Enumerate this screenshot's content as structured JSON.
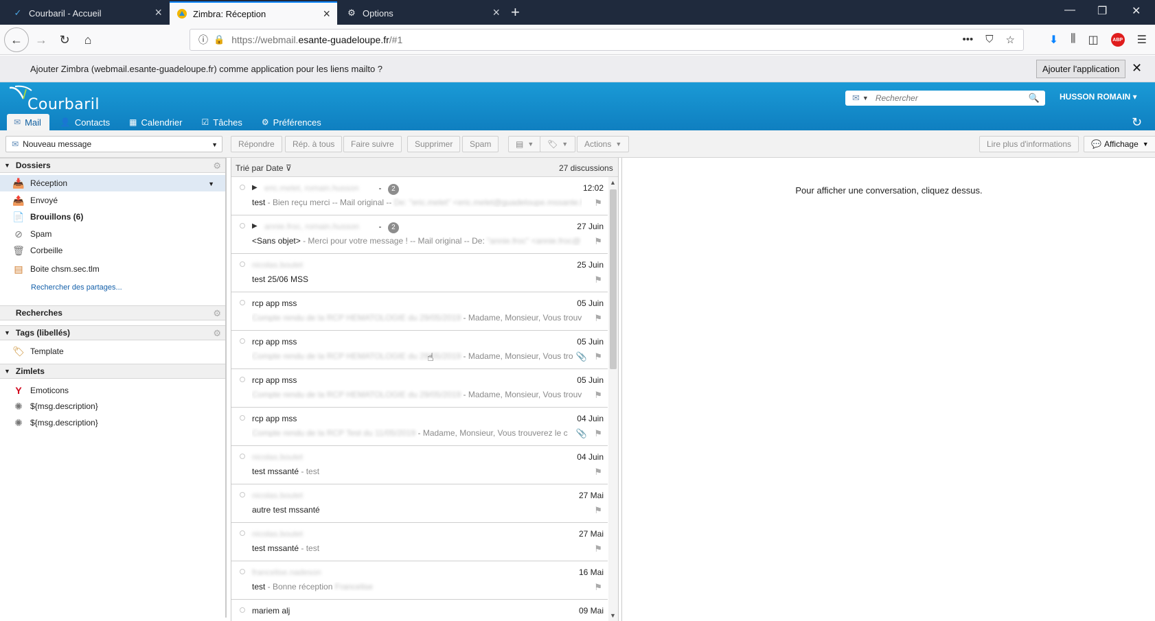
{
  "browser": {
    "tabs": [
      {
        "label": "Courbaril - Accueil",
        "icon": "courbaril-icon"
      },
      {
        "label": "Zimbra: Réception",
        "icon": "zimbra-icon"
      },
      {
        "label": "Options",
        "icon": "gear-icon"
      }
    ],
    "url": {
      "prefix": "https://webmail.",
      "domain": "esante-guadeloupe.fr",
      "suffix": "/#1"
    }
  },
  "notification": {
    "text": "Ajouter Zimbra (webmail.esante-guadeloupe.fr) comme application pour les liens mailto ?",
    "button_label": "Ajouter l'application"
  },
  "app": {
    "logo_text": "Courbaril",
    "search_placeholder": "Rechercher",
    "user_name": "HUSSON ROMAIN",
    "tabs": [
      "Mail",
      "Contacts",
      "Calendrier",
      "Tâches",
      "Préférences"
    ]
  },
  "toolbar": {
    "new_message": "Nouveau message",
    "reply": "Répondre",
    "reply_all": "Rép. à tous",
    "forward": "Faire suivre",
    "delete": "Supprimer",
    "spam": "Spam",
    "actions": "Actions",
    "more_info": "Lire plus d'informations",
    "view": "Affichage"
  },
  "sidebar": {
    "folders_header": "Dossiers",
    "folders": [
      {
        "label": "Réception",
        "icon": "inbox-icon"
      },
      {
        "label": "Envoyé",
        "icon": "sent-icon"
      },
      {
        "label": "Brouillons (6)",
        "icon": "drafts-icon"
      },
      {
        "label": "Spam",
        "icon": "spam-icon"
      },
      {
        "label": "Corbeille",
        "icon": "trash-icon"
      },
      {
        "label": "Boite chsm.sec.tlm",
        "icon": "shared-mailbox-icon"
      }
    ],
    "find_shares": "Rechercher des partages...",
    "searches_header": "Recherches",
    "tags_header": "Tags (libellés)",
    "tags": [
      {
        "label": "Template",
        "icon": "tag-icon"
      }
    ],
    "zimlets_header": "Zimlets",
    "zimlets": [
      {
        "label": "Emoticons",
        "icon": "yahoo-icon"
      },
      {
        "label": "${msg.description}",
        "icon": "zimlet-icon"
      },
      {
        "label": "${msg.description}",
        "icon": "zimlet-icon"
      }
    ]
  },
  "list": {
    "sort_label": "Trié par Date",
    "count_label": "27 discussions",
    "messages": [
      {
        "from": "eric.melet, romain.husson",
        "count": "2",
        "date": "12:02",
        "subject": "test",
        "fragment": " - Bien reçu merci -- Mail original -- ",
        "blur_tail": "De: \"eric.melet\" <eric.melet@guadeloupe.mssante.fr>",
        "expand": true,
        "attach": false,
        "from_blur": true
      },
      {
        "from": "annie.froc, romain.husson",
        "count": "2",
        "date": "27 Juin",
        "subject": "<Sans objet>",
        "fragment": " - Merci pour votre message ! -- Mail original -- De: ",
        "blur_tail": "\"annie.froc\" <annie.froc@",
        "expand": true,
        "attach": false,
        "from_blur": true
      },
      {
        "from": "nicolas.boutet",
        "count": "",
        "date": "25 Juin",
        "subject": "test 25/06 MSS",
        "fragment": "",
        "blur_tail": "",
        "expand": false,
        "attach": false,
        "from_blur": true
      },
      {
        "from": "rcp app mss",
        "count": "",
        "date": "05 Juin",
        "subject": "",
        "fragment": " - Madame, Monsieur, Vous trouve",
        "blur_tail": "Compte rendu de la RCP HEMATOLOGIE du 29/05/2019",
        "blur_first": true,
        "expand": false,
        "attach": false,
        "from_blur": false
      },
      {
        "from": "rcp app mss",
        "count": "",
        "date": "05 Juin",
        "subject": "",
        "fragment": " - Madame, Monsieur, Vous tro",
        "blur_tail": "Compte rendu de la RCP HEMATOLOGIE du 29/05/2019",
        "blur_first": true,
        "expand": false,
        "attach": true,
        "from_blur": false
      },
      {
        "from": "rcp app mss",
        "count": "",
        "date": "05 Juin",
        "subject": "",
        "fragment": " - Madame, Monsieur, Vous trouve",
        "blur_tail": "Compte rendu de la RCP HEMATOLOGIE du 29/05/2019",
        "blur_first": true,
        "expand": false,
        "attach": false,
        "from_blur": false
      },
      {
        "from": "rcp app mss",
        "count": "",
        "date": "04 Juin",
        "subject": "",
        "fragment": " - Madame, Monsieur, Vous trouverez le c",
        "blur_tail": "Compte rendu de la RCP Test du 11/05/2019",
        "blur_first": true,
        "expand": false,
        "attach": true,
        "from_blur": false
      },
      {
        "from": "nicolas.boutet",
        "count": "",
        "date": "04 Juin",
        "subject": "test mssanté",
        "fragment": " - test",
        "blur_tail": "",
        "expand": false,
        "attach": false,
        "from_blur": true
      },
      {
        "from": "nicolas.boutet",
        "count": "",
        "date": "27 Mai",
        "subject": "autre test mssanté",
        "fragment": "",
        "blur_tail": "",
        "expand": false,
        "attach": false,
        "from_blur": true
      },
      {
        "from": "nicolas.boutet",
        "count": "",
        "date": "27 Mai",
        "subject": "test mssanté",
        "fragment": " - test",
        "blur_tail": "",
        "expand": false,
        "attach": false,
        "from_blur": true
      },
      {
        "from": "francelise.nadeson",
        "count": "",
        "date": "16 Mai",
        "subject": "test",
        "fragment": " - Bonne réception ",
        "blur_tail": "Francelise",
        "expand": false,
        "attach": false,
        "from_blur": true
      },
      {
        "from": "mariem alj",
        "count": "",
        "date": "09 Mai",
        "subject": "",
        "fragment": "",
        "blur_tail": "",
        "expand": false,
        "attach": false,
        "from_blur": false
      }
    ]
  },
  "reading_pane": {
    "hint": "Pour afficher une conversation, cliquez dessus."
  }
}
